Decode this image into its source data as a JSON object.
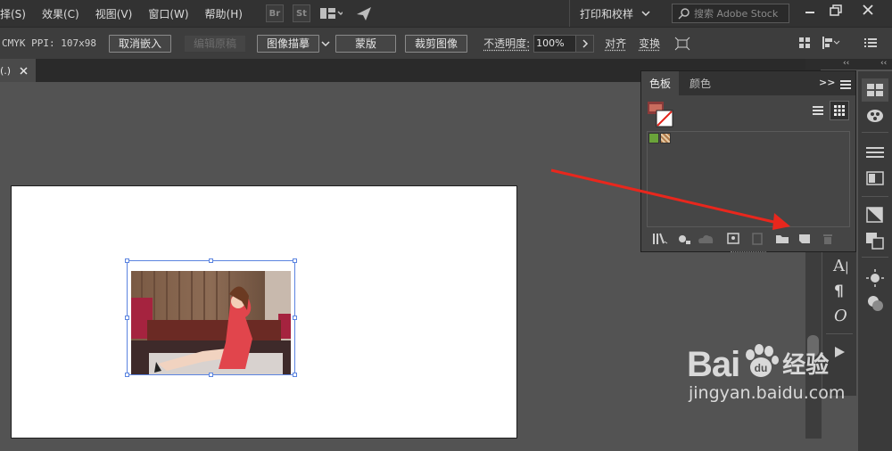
{
  "menubar": {
    "items": [
      "择(S)",
      "效果(C)",
      "视图(V)",
      "窗口(W)",
      "帮助(H)"
    ],
    "app_icons": [
      "Br",
      "St"
    ],
    "workspace": "打印和校样",
    "search_placeholder": "搜索 Adobe Stock"
  },
  "controlbar": {
    "info": "CMYK  PPI: 107x98",
    "cancel_embed": "取消嵌入",
    "edit_original": "编辑原稿",
    "image_trace": "图像描摹",
    "mask": "蒙版",
    "crop_image": "裁剪图像",
    "opacity_label": "不透明度:",
    "opacity_value": "100%",
    "align": "对齐",
    "transform": "变换"
  },
  "document": {
    "tab_title": "(.)"
  },
  "swatches_panel": {
    "tabs": [
      "色板",
      "颜色"
    ],
    "more": ">>"
  },
  "watermark": {
    "brand": "Bai",
    "brand2": "经验",
    "url": "jingyan.baidu.com"
  },
  "colors": {
    "accent_arrow": "#e8271d",
    "selection": "#5b84e0"
  }
}
